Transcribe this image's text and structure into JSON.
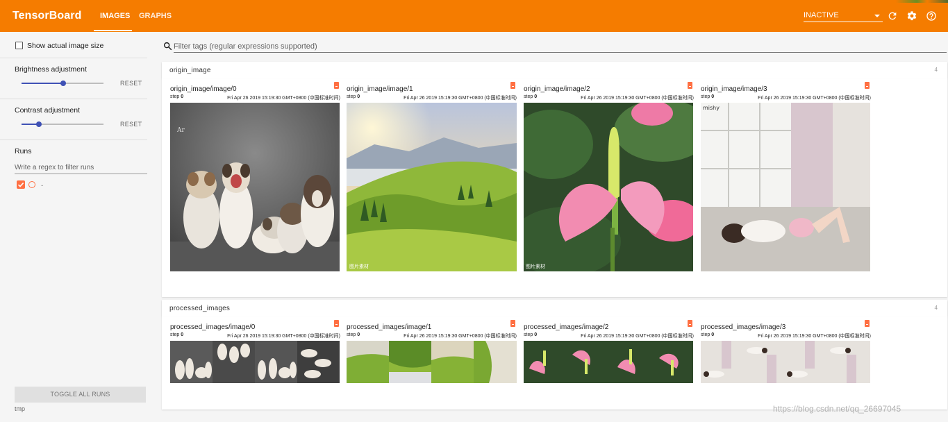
{
  "app": {
    "title": "TensorBoard",
    "tabs": [
      {
        "label": "IMAGES",
        "active": true
      },
      {
        "label": "GRAPHS",
        "active": false
      }
    ],
    "reload_select": "INACTIVE",
    "accent_color": "#f57c00",
    "icons": [
      "refresh-icon",
      "gear-icon",
      "help-icon"
    ]
  },
  "sidebar": {
    "show_actual_size": "Show actual image size",
    "brightness": {
      "label": "Brightness adjustment",
      "reset": "RESET",
      "value_fraction": 0.5
    },
    "contrast": {
      "label": "Contrast adjustment",
      "reset": "RESET",
      "value_fraction": 0.2
    },
    "runs": {
      "label": "Runs",
      "filter_placeholder": "Write a regex to filter runs",
      "items": [
        {
          "label": ".",
          "checked": true,
          "color": "#ff7043"
        }
      ]
    },
    "toggle_all": "TOGGLE ALL RUNS",
    "logdir": "tmp"
  },
  "filter": {
    "placeholder": "Filter tags (regular expressions supported)"
  },
  "sections": [
    {
      "name": "origin_image",
      "count": "4",
      "cards": [
        {
          "title": "origin_image/image/0",
          "step_label": "step",
          "step": "0",
          "time": "Fri Apr 26 2019 15:19:30 GMT+0800 (中国标准时间)"
        },
        {
          "title": "origin_image/image/1",
          "step_label": "step",
          "step": "0",
          "time": "Fri Apr 26 2019 15:19:30 GMT+0800 (中国标准时间)"
        },
        {
          "title": "origin_image/image/2",
          "step_label": "step",
          "step": "0",
          "time": "Fri Apr 26 2019 15:19:30 GMT+0800 (中国标准时间)"
        },
        {
          "title": "origin_image/image/3",
          "step_label": "step",
          "step": "0",
          "time": "Fri Apr 26 2019 15:19:30 GMT+0800 (中国标准时间)"
        }
      ]
    },
    {
      "name": "processed_images",
      "count": "4",
      "cards": [
        {
          "title": "processed_images/image/0",
          "step_label": "step",
          "step": "0",
          "time": "Fri Apr 26 2019 15:19:30 GMT+0800 (中国标准时间)"
        },
        {
          "title": "processed_images/image/1",
          "step_label": "step",
          "step": "0",
          "time": "Fri Apr 26 2019 15:19:30 GMT+0800 (中国标准时间)"
        },
        {
          "title": "processed_images/image/2",
          "step_label": "step",
          "step": "0",
          "time": "Fri Apr 26 2019 15:19:30 GMT+0800 (中国标准时间)"
        },
        {
          "title": "processed_images/image/3",
          "step_label": "step",
          "step": "0",
          "time": "Fri Apr 26 2019 15:19:30 GMT+0800 (中国标准时间)"
        }
      ]
    }
  ],
  "watermark": "https://blog.csdn.net/qq_26697045"
}
